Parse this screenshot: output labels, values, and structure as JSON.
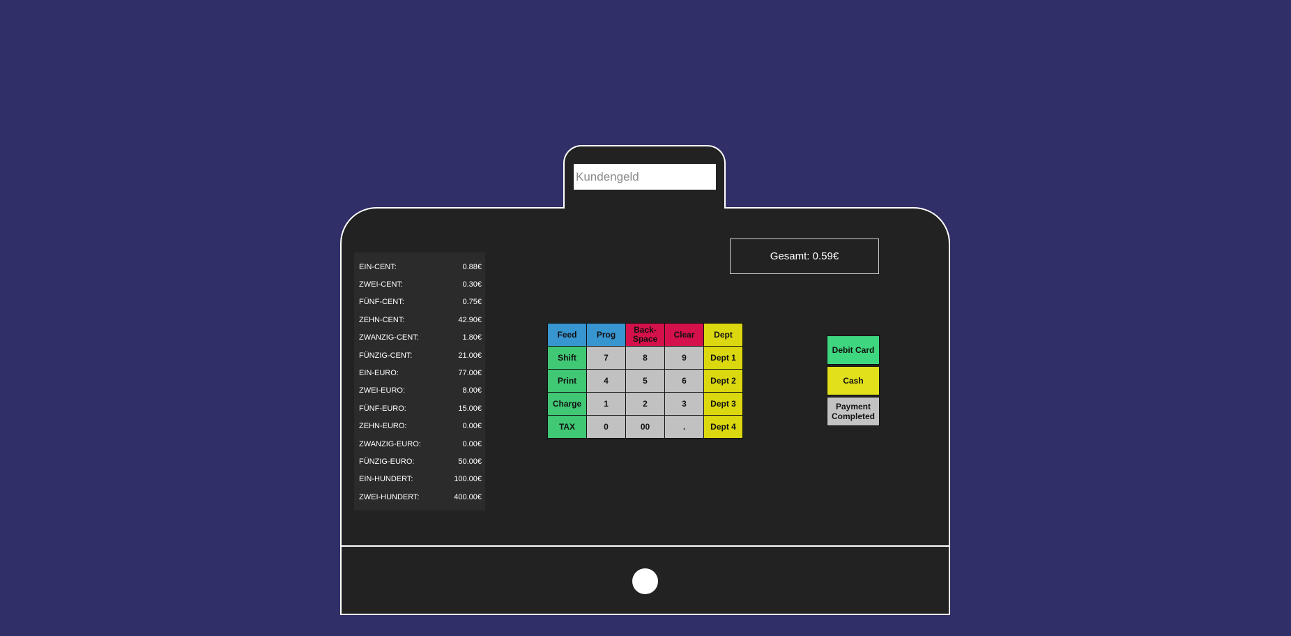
{
  "register": {
    "input_placeholder": "Kundengeld",
    "total_text": "Gesamt: 0.59€"
  },
  "coins": [
    {
      "label": "EIN-CENT:",
      "value": "0.88€"
    },
    {
      "label": "ZWEI-CENT:",
      "value": "0.30€"
    },
    {
      "label": "FÜNF-CENT:",
      "value": "0.75€"
    },
    {
      "label": "ZEHN-CENT:",
      "value": "42.90€"
    },
    {
      "label": "ZWANZIG-CENT:",
      "value": "1.80€"
    },
    {
      "label": "FÜNZIG-CENT:",
      "value": "21.00€"
    },
    {
      "label": "EIN-EURO:",
      "value": "77.00€"
    },
    {
      "label": "ZWEI-EURO:",
      "value": "8.00€"
    },
    {
      "label": "FÜNF-EURO:",
      "value": "15.00€"
    },
    {
      "label": "ZEHN-EURO:",
      "value": "0.00€"
    },
    {
      "label": "ZWANZIG-EURO:",
      "value": "0.00€"
    },
    {
      "label": "FÜNZIG-EURO:",
      "value": "50.00€"
    },
    {
      "label": "EIN-HUNDERT:",
      "value": "100.00€"
    },
    {
      "label": "ZWEI-HUNDERT:",
      "value": "400.00€"
    }
  ],
  "keypad": {
    "rows": [
      [
        {
          "label": "Feed",
          "name": "feed-key",
          "color": "blue"
        },
        {
          "label": "Prog",
          "name": "prog-key",
          "color": "blue"
        },
        {
          "label": "Back-\nSpace",
          "name": "backspace-key",
          "color": "red"
        },
        {
          "label": "Clear",
          "name": "clear-key",
          "color": "red"
        },
        {
          "label": "Dept",
          "name": "dept-key",
          "color": "yellow"
        }
      ],
      [
        {
          "label": "Shift",
          "name": "shift-key",
          "color": "green"
        },
        {
          "label": "7",
          "name": "digit-7-key",
          "color": "grey"
        },
        {
          "label": "8",
          "name": "digit-8-key",
          "color": "grey"
        },
        {
          "label": "9",
          "name": "digit-9-key",
          "color": "grey"
        },
        {
          "label": "Dept 1",
          "name": "dept-1-key",
          "color": "yellow"
        }
      ],
      [
        {
          "label": "Print",
          "name": "print-key",
          "color": "green"
        },
        {
          "label": "4",
          "name": "digit-4-key",
          "color": "grey"
        },
        {
          "label": "5",
          "name": "digit-5-key",
          "color": "grey"
        },
        {
          "label": "6",
          "name": "digit-6-key",
          "color": "grey"
        },
        {
          "label": "Dept 2",
          "name": "dept-2-key",
          "color": "yellow"
        }
      ],
      [
        {
          "label": "Charge",
          "name": "charge-key",
          "color": "green"
        },
        {
          "label": "1",
          "name": "digit-1-key",
          "color": "grey"
        },
        {
          "label": "2",
          "name": "digit-2-key",
          "color": "grey"
        },
        {
          "label": "3",
          "name": "digit-3-key",
          "color": "grey"
        },
        {
          "label": "Dept 3",
          "name": "dept-3-key",
          "color": "yellow"
        }
      ],
      [
        {
          "label": "TAX",
          "name": "tax-key",
          "color": "green"
        },
        {
          "label": "0",
          "name": "digit-0-key",
          "color": "grey"
        },
        {
          "label": "00",
          "name": "double-zero-key",
          "color": "grey"
        },
        {
          "label": ".",
          "name": "decimal-point-key",
          "color": "grey"
        },
        {
          "label": "Dept 4",
          "name": "dept-4-key",
          "color": "yellow"
        }
      ]
    ]
  },
  "payment": {
    "debit_card": "Debit Card",
    "cash": "Cash",
    "completed": "Payment\nCompleted"
  },
  "colors": {
    "background": "#312f68",
    "register": "#222222",
    "blue": "#3795d0",
    "red": "#d4114a",
    "yellow": "#dbd80f",
    "green": "#40c875",
    "grey": "#c1c1c1",
    "debit_card": "#3ed67e",
    "cash": "#e1e01a",
    "payment_completed": "#c3c3c3"
  }
}
